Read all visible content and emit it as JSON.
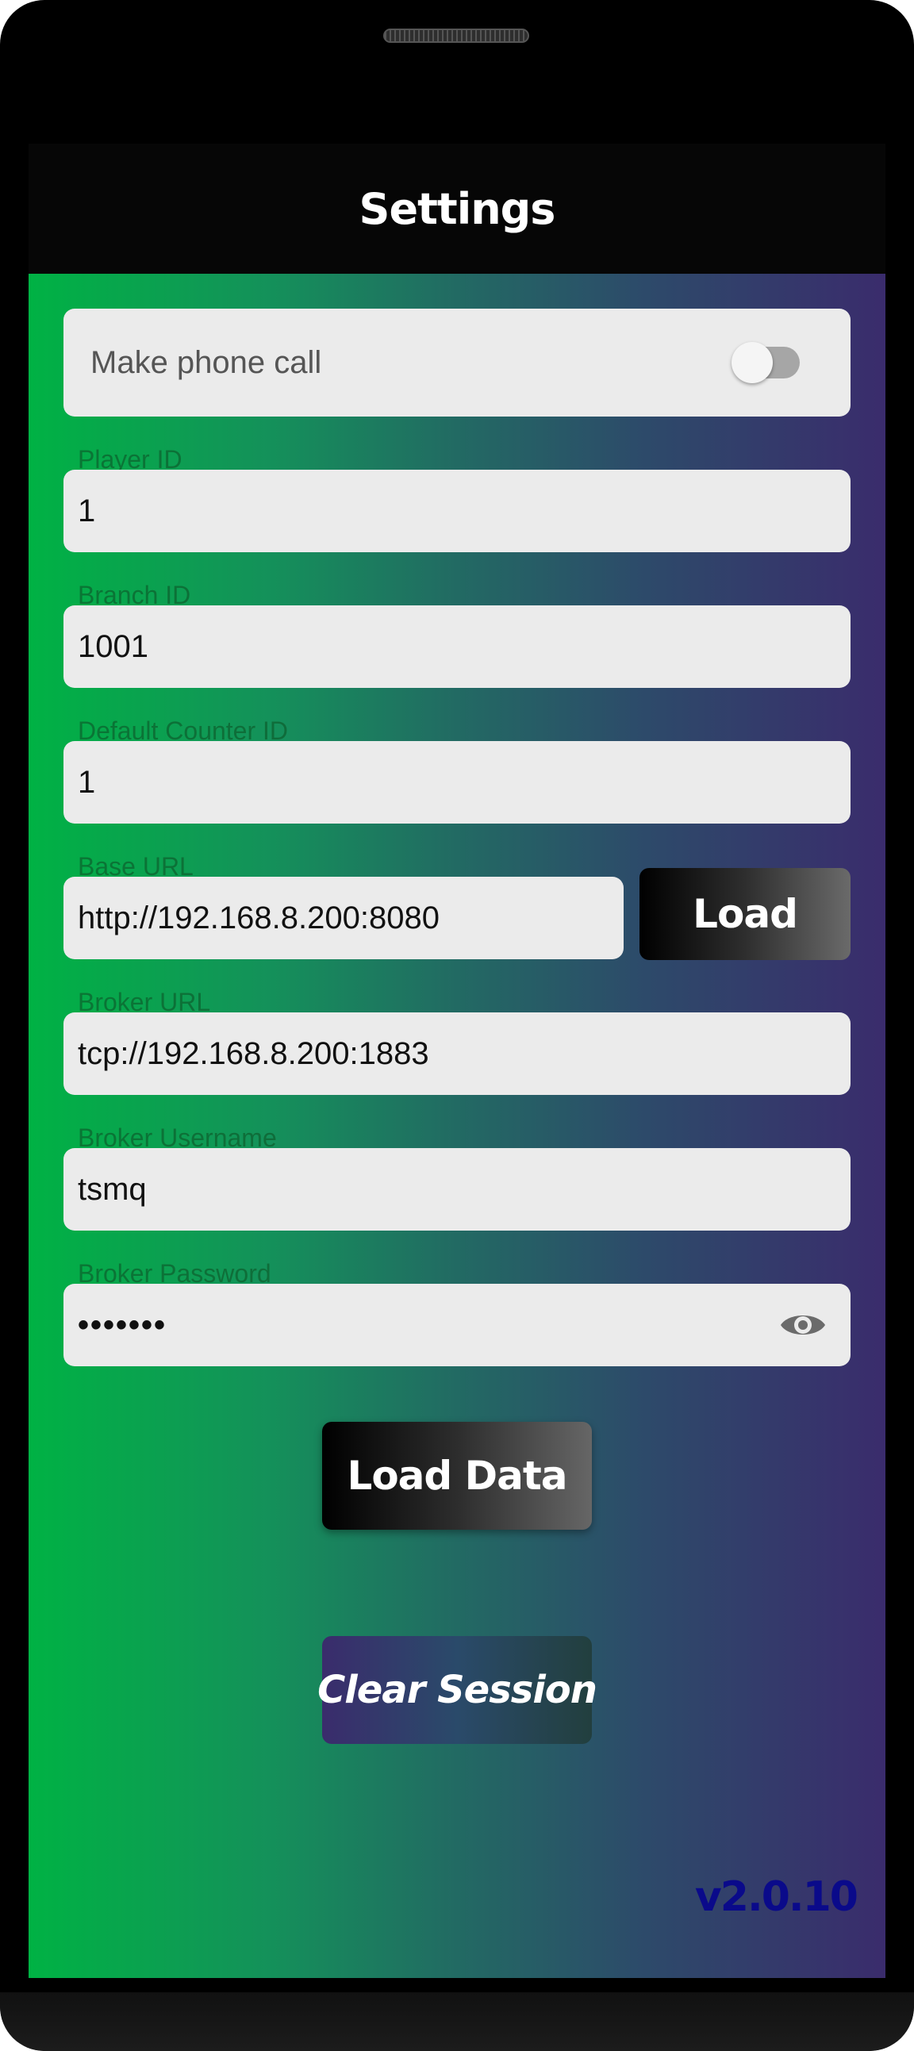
{
  "appbar": {
    "title": "Settings"
  },
  "toggle": {
    "label": "Make phone call",
    "enabled": false
  },
  "fields": {
    "player_id": {
      "label": "Player ID",
      "value": "1"
    },
    "branch_id": {
      "label": "Branch ID",
      "value": "1001"
    },
    "default_counter_id": {
      "label": "Default Counter ID",
      "value": "1"
    },
    "base_url": {
      "label": "Base URL",
      "value": "http://192.168.8.200:8080"
    },
    "broker_url": {
      "label": "Broker URL",
      "value": "tcp://192.168.8.200:1883"
    },
    "broker_username": {
      "label": "Broker Username",
      "value": "tsmq"
    },
    "broker_password": {
      "label": "Broker Password",
      "value": "•••••••"
    }
  },
  "buttons": {
    "load": "Load",
    "load_data": "Load Data",
    "clear_session": "Clear Session"
  },
  "icons": {
    "password_visibility": "eye-icon"
  },
  "version": "v2.0.10",
  "colors": {
    "gradient_start": "#00b244",
    "gradient_end": "#3a2c6c",
    "field_background": "#ebebeb",
    "version_text": "#0a0a8a"
  }
}
